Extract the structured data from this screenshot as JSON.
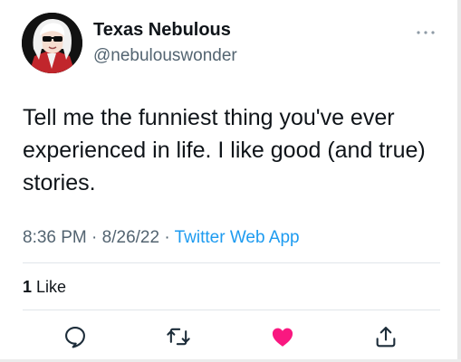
{
  "author": {
    "display_name": "Texas Nebulous",
    "handle": "@nebulouswonder",
    "avatar_icon": "profile-avatar"
  },
  "tweet": {
    "text": "Tell me the funniest thing you've ever experienced in life. I like good (and true) stories.",
    "time": "8:36 PM",
    "date": "8/26/22",
    "separator": "·",
    "source": "Twitter Web App"
  },
  "stats": {
    "like_count": "1",
    "like_label": "Like"
  },
  "actions": [
    {
      "name": "reply",
      "icon": "comment-icon"
    },
    {
      "name": "retweet",
      "icon": "retweet-icon"
    },
    {
      "name": "like",
      "icon": "heart-icon",
      "active": true
    },
    {
      "name": "share",
      "icon": "share-icon"
    }
  ],
  "colors": {
    "text_primary": "#0f1419",
    "text_secondary": "#536471",
    "link": "#1d9bf0",
    "like_active": "#f91880",
    "divider": "#e1e6ea"
  }
}
